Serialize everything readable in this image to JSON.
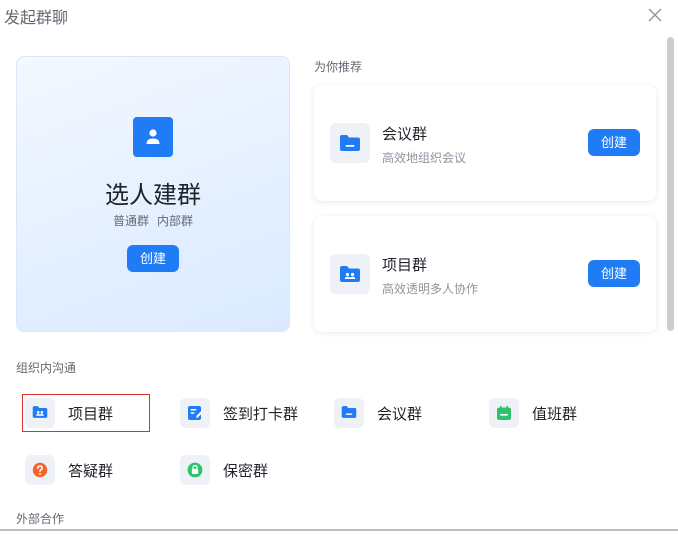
{
  "dialog": {
    "title": "发起群聊",
    "close_icon": "close-icon"
  },
  "hero": {
    "icon": "person-icon",
    "title": "选人建群",
    "subtitle_items": [
      "普通群",
      "内部群"
    ],
    "create_label": "创建",
    "accent": "#1f7cf5"
  },
  "recommend": {
    "label": "为你推荐",
    "cards": [
      {
        "icon": "folder-icon",
        "name": "会议群",
        "desc": "高效地组织会议",
        "create_label": "创建"
      },
      {
        "icon": "folder-people-icon",
        "name": "项目群",
        "desc": "高效透明多人协作",
        "create_label": "创建"
      }
    ]
  },
  "internal": {
    "label": "组织内沟通",
    "groups": [
      {
        "icon": "folder-people-icon",
        "label": "项目群",
        "selected": true,
        "color": "#1f7cf5"
      },
      {
        "icon": "signin-edit-icon",
        "label": "签到打卡群",
        "color": "#1f7cf5"
      },
      {
        "icon": "folder-icon",
        "label": "会议群",
        "color": "#1f7cf5"
      },
      {
        "icon": "calendar-icon",
        "label": "值班群",
        "color": "#2ec26b"
      },
      {
        "icon": "question-icon",
        "label": "答疑群",
        "color": "#f5632a"
      },
      {
        "icon": "lock-icon",
        "label": "保密群",
        "color": "#2ec26b"
      }
    ]
  },
  "external": {
    "label": "外部合作"
  }
}
